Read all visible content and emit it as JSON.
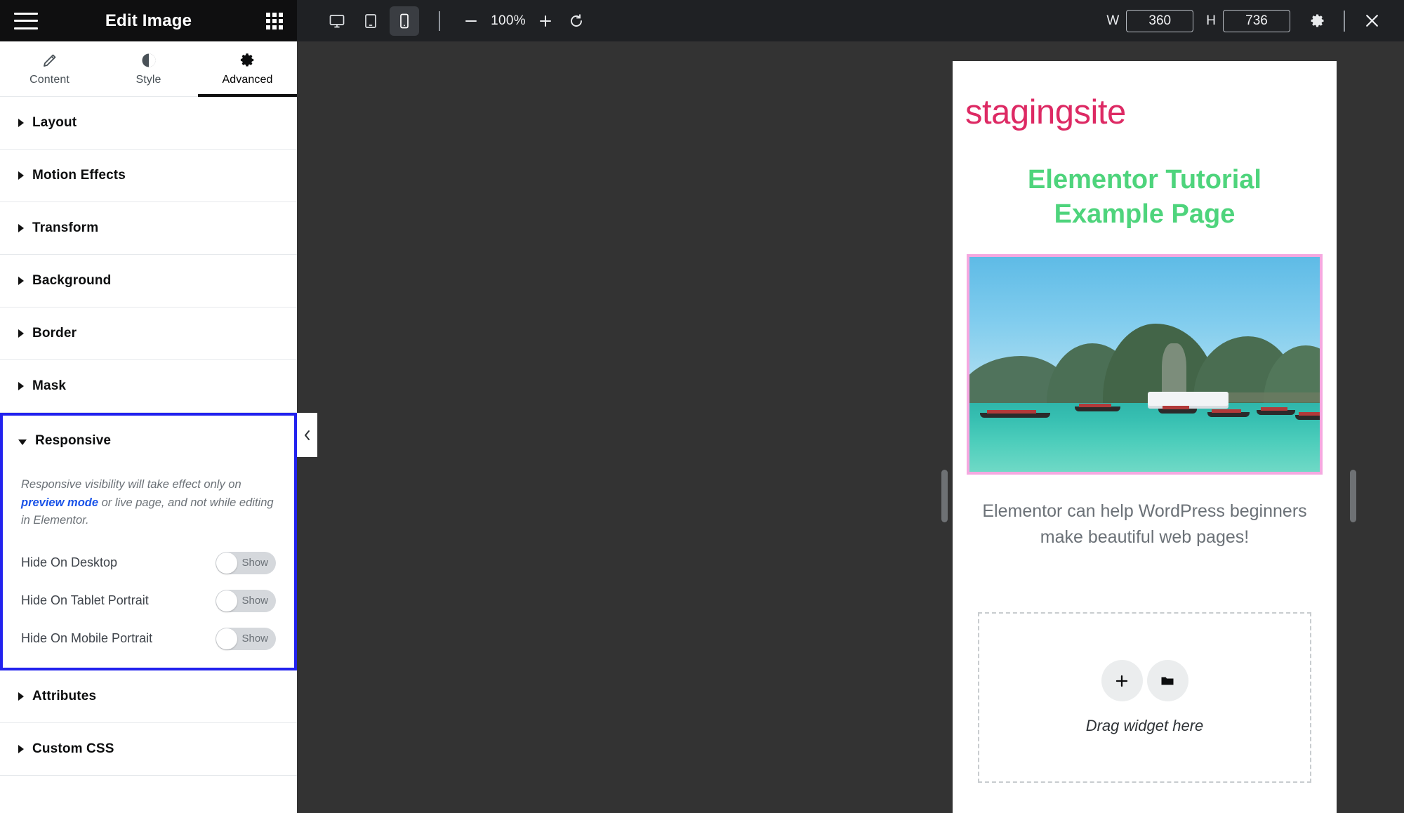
{
  "panel": {
    "header": {
      "title": "Edit Image",
      "menu_icon": "hamburger-icon",
      "apps_icon": "apps-grid-icon"
    },
    "tabs": [
      {
        "label": "Content",
        "icon": "pencil-icon",
        "active": false
      },
      {
        "label": "Style",
        "icon": "contrast-icon",
        "active": false
      },
      {
        "label": "Advanced",
        "icon": "gear-icon",
        "active": true
      }
    ],
    "sections_top": [
      {
        "label": "Layout"
      },
      {
        "label": "Motion Effects"
      },
      {
        "label": "Transform"
      },
      {
        "label": "Background"
      },
      {
        "label": "Border"
      },
      {
        "label": "Mask"
      }
    ],
    "responsive": {
      "label": "Responsive",
      "note_before": "Responsive visibility will take effect only on ",
      "note_link": "preview mode",
      "note_after": " or live page, and not while editing in Elementor.",
      "toggles": [
        {
          "label": "Hide On Desktop",
          "state": "Show"
        },
        {
          "label": "Hide On Tablet Portrait",
          "state": "Show"
        },
        {
          "label": "Hide On Mobile Portrait",
          "state": "Show"
        }
      ]
    },
    "sections_bottom": [
      {
        "label": "Attributes"
      },
      {
        "label": "Custom CSS"
      }
    ],
    "collapse_icon": "chevron-left-icon"
  },
  "toolbar": {
    "devices": [
      {
        "name": "desktop-icon",
        "active": false
      },
      {
        "name": "tablet-icon",
        "active": false
      },
      {
        "name": "mobile-icon",
        "active": true
      }
    ],
    "zoom_out_icon": "minus-icon",
    "zoom_value": "100%",
    "zoom_in_icon": "plus-icon",
    "reset_icon": "reset-icon",
    "width_label": "W",
    "width_value": "360",
    "height_label": "H",
    "height_value": "736",
    "settings_icon": "gear-icon",
    "close_icon": "close-icon"
  },
  "preview": {
    "site_title": "stagingsite",
    "page_heading": "Elementor Tutorial Example Page",
    "body_copy": "Elementor can help WordPress beginners make beautiful web pages!",
    "image_alt": "tropical-bay-longtail-boats-photo",
    "dropzone": {
      "add_icon": "plus-icon",
      "folder_icon": "folder-icon",
      "text": "Drag widget here"
    }
  },
  "colors": {
    "accent_blue": "#2222ee",
    "link_blue": "#1a53e8",
    "site_title_pink": "#dd2a64",
    "heading_green": "#4ed47c",
    "image_border_pink": "#f5a8e0",
    "panel_header_dark": "#0f0f10",
    "topbar_dark": "#1f2124",
    "stage_bg": "#333333"
  }
}
